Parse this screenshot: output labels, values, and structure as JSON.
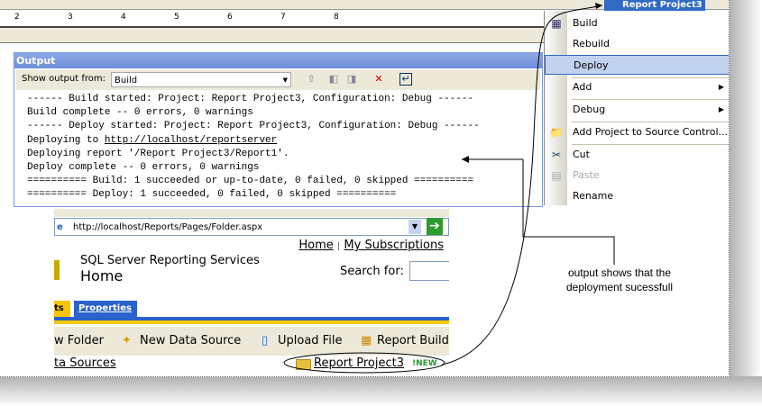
{
  "ruler": {
    "ticks": [
      "2",
      "3",
      "4",
      "5",
      "6",
      "7",
      "8"
    ]
  },
  "output": {
    "title": "Output",
    "show_from_label": "Show output from:",
    "show_from_value": "Build",
    "lines": [
      "------ Build started: Project: Report Project3, Configuration: Debug ------",
      "Build complete -- 0 errors, 0 warnings",
      "------ Deploy started: Project: Report Project3, Configuration: Debug ------",
      "Deploying report '/Report Project3/Report1'.",
      "Deploy complete -- 0 errors, 0 warnings",
      "========== Build: 1 succeeded or up-to-date, 0 failed, 0 skipped ==========",
      "========== Deploy: 1 succeeded, 0 failed, 0 skipped =========="
    ],
    "deploy_prefix": "Deploying to ",
    "deploy_url": "http://localhost/reportserver"
  },
  "context_menu": {
    "header": "Report Project3",
    "items": [
      {
        "label": "Build",
        "icon": "build-icon"
      },
      {
        "label": "Rebuild"
      },
      {
        "label": "Deploy",
        "highlighted": true
      },
      {
        "label": "Add",
        "submenu": true
      },
      {
        "label": "Debug",
        "submenu": true
      },
      {
        "label": "Add Project to Source Control...",
        "icon": "folder-add-icon"
      },
      {
        "label": "Cut",
        "icon": "scissors-icon"
      },
      {
        "label": "Paste",
        "disabled": true,
        "icon": "paste-icon"
      },
      {
        "label": "Rename"
      }
    ]
  },
  "web": {
    "address": "http://localhost/Reports/Pages/Folder.aspx",
    "nav_home": "Home",
    "nav_sep": "|",
    "nav_subs": "My Subscriptions",
    "app_title": "SQL Server Reporting Services",
    "page_title": "Home",
    "search_label": "Search for:",
    "tab_contents_partial": "ts",
    "tab_properties": "Properties",
    "toolbar": [
      "w Folder",
      "New Data Source",
      "Upload File",
      "Report Builde"
    ],
    "data_sources_partial": "ta Sources",
    "item": "Report Project3",
    "new_badge": "!NEW"
  },
  "callout": {
    "line1": "output shows that the",
    "line2": "deployment sucessfull"
  },
  "colors": {
    "title_blue": "#6d8fd9",
    "menu_highlight": "#c1d2ee",
    "tab_blue": "#2a62c9",
    "tab_yellow": "#f7c600"
  }
}
